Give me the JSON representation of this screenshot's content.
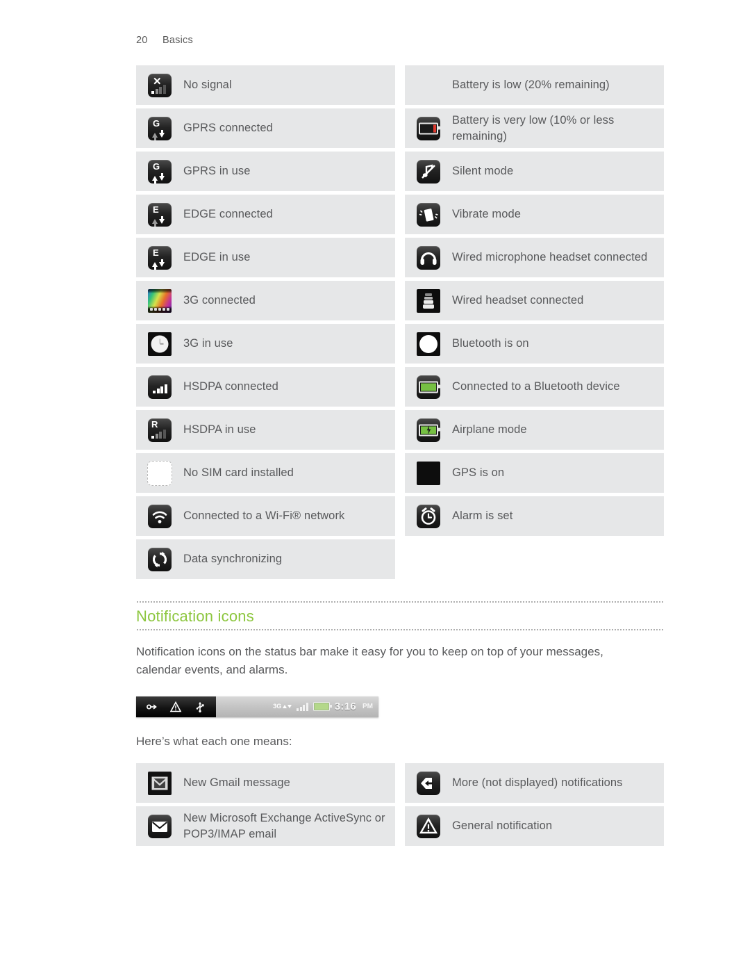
{
  "running_header": {
    "page_number": "20",
    "section": "Basics"
  },
  "status_icons": {
    "left_column": [
      {
        "icon": "no-signal-icon",
        "label": "No signal"
      },
      {
        "icon": "gprs-connected-icon",
        "label": "GPRS connected"
      },
      {
        "icon": "gprs-in-use-icon",
        "label": "GPRS in use"
      },
      {
        "icon": "edge-connected-icon",
        "label": "EDGE connected"
      },
      {
        "icon": "edge-in-use-icon",
        "label": "EDGE in use"
      },
      {
        "icon": "3g-connected-icon",
        "label": "3G connected"
      },
      {
        "icon": "3g-in-use-icon",
        "label": "3G in use"
      },
      {
        "icon": "hsdpa-connected-icon",
        "label": "HSDPA connected"
      },
      {
        "icon": "hsdpa-in-use-icon",
        "label": "HSDPA in use"
      },
      {
        "icon": "no-sim-card-icon",
        "label": "No SIM card installed"
      },
      {
        "icon": "wifi-connected-icon",
        "label": "Connected to a Wi-Fi® network"
      },
      {
        "icon": "data-synchronizing-icon",
        "label": "Data synchronizing"
      }
    ],
    "right_column": [
      {
        "icon": "battery-low-icon",
        "label": "Battery is low (20% remaining)"
      },
      {
        "icon": "battery-very-low-icon",
        "label": "Battery is very low (10% or less remaining)"
      },
      {
        "icon": "silent-mode-icon",
        "label": "Silent mode"
      },
      {
        "icon": "vibrate-mode-icon",
        "label": "Vibrate mode"
      },
      {
        "icon": "wired-microphone-headset-icon",
        "label": "Wired microphone headset connected"
      },
      {
        "icon": "wired-headset-icon",
        "label": "Wired headset connected"
      },
      {
        "icon": "bluetooth-on-icon",
        "label": "Bluetooth is on"
      },
      {
        "icon": "bluetooth-connected-icon",
        "label": "Connected to a Bluetooth device"
      },
      {
        "icon": "airplane-mode-icon",
        "label": "Airplane mode"
      },
      {
        "icon": "gps-on-icon",
        "label": "GPS is on"
      },
      {
        "icon": "alarm-set-icon",
        "label": "Alarm is set"
      }
    ]
  },
  "notification_section": {
    "heading": "Notification icons",
    "accent_color": "#8cc63e",
    "intro_paragraph": "Notification icons on the status bar make it easy for you to keep on top of your messages, calendar events, and alarms.",
    "lead_in": "Here’s what each one means:",
    "status_bar_figure": {
      "left_icons": [
        "link-arrow-icon",
        "warning-triangle-icon",
        "usb-icon"
      ],
      "right_icons": [
        "3g-data-icon",
        "signal-bars-icon",
        "battery-icon"
      ],
      "network_label": "3G",
      "time": "3:16",
      "meridiem": "PM"
    },
    "left_column": [
      {
        "icon": "gmail-icon",
        "label": "New Gmail message"
      },
      {
        "icon": "email-envelope-icon",
        "label": "New Microsoft Exchange ActiveSync or POP3/IMAP email"
      }
    ],
    "right_column": [
      {
        "icon": "more-notifications-icon",
        "label": "More (not displayed) notifications"
      },
      {
        "icon": "general-notification-icon",
        "label": "General notification"
      }
    ]
  }
}
